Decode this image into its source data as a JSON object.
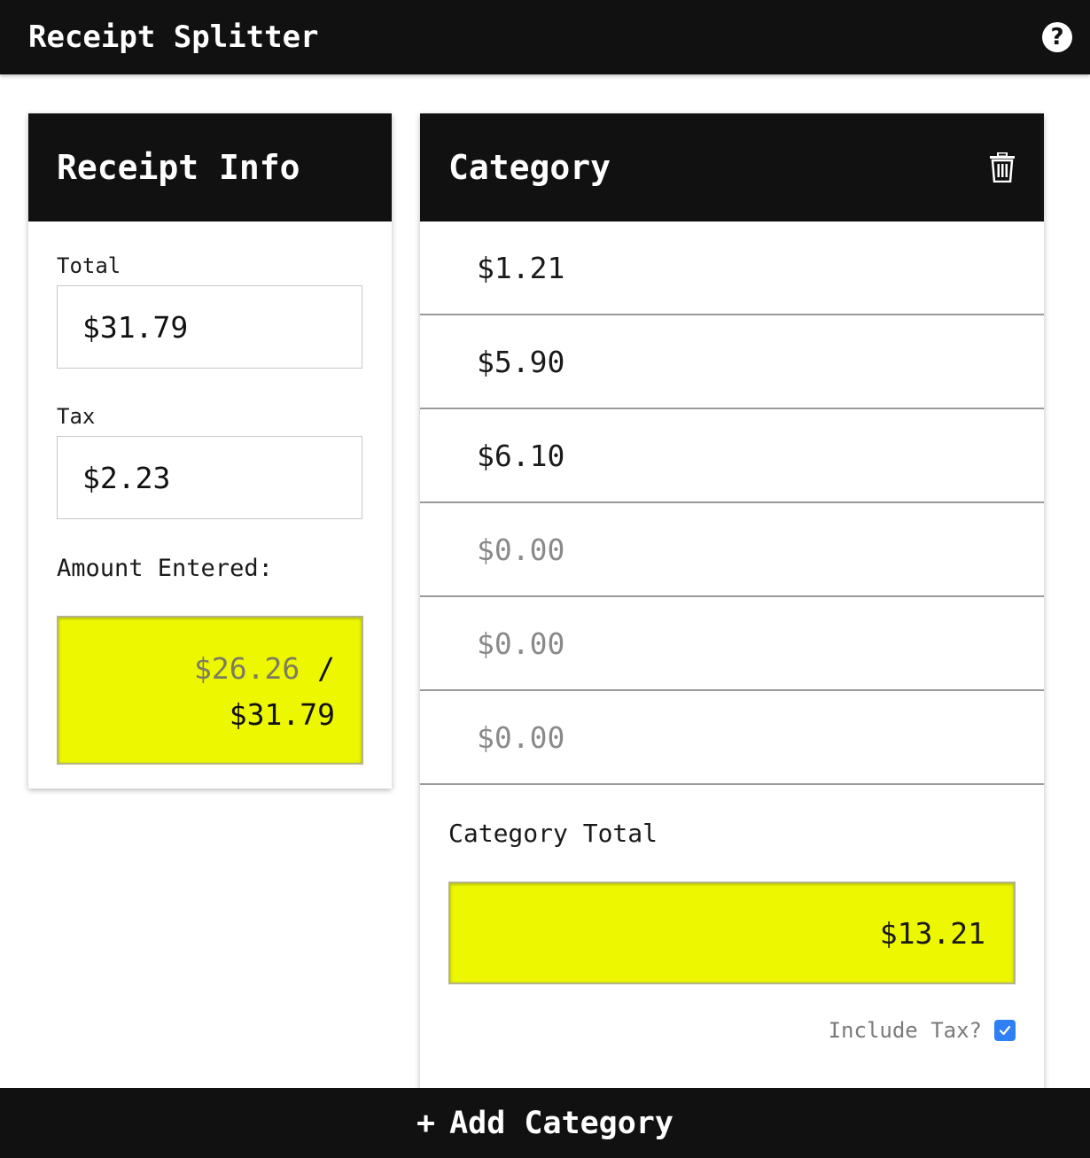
{
  "app": {
    "title": "Receipt Splitter",
    "help_icon": "question-circle-icon"
  },
  "receipt": {
    "header": "Receipt Info",
    "total_label": "Total",
    "total_value": "$31.79",
    "tax_label": "Tax",
    "tax_value": "$2.23",
    "amount_label": "Amount Entered:",
    "amount_entered": "$26.26",
    "amount_separator": "/",
    "amount_total": "$31.79"
  },
  "category": {
    "header": "Category",
    "delete_icon": "trash-icon",
    "items": [
      {
        "value": "$1.21",
        "placeholder": false
      },
      {
        "value": "$5.90",
        "placeholder": false
      },
      {
        "value": "$6.10",
        "placeholder": false
      },
      {
        "value": "$0.00",
        "placeholder": true
      },
      {
        "value": "$0.00",
        "placeholder": true
      },
      {
        "value": "$0.00",
        "placeholder": true
      }
    ],
    "total_label": "Category Total",
    "total_value": "$13.21",
    "include_tax_label": "Include Tax?",
    "include_tax_checked": true
  },
  "footer": {
    "add_icon": "+",
    "add_label": "Add Category"
  },
  "colors": {
    "highlight": "#ecf700",
    "bar": "#111111",
    "checkbox": "#2f7ff5"
  }
}
